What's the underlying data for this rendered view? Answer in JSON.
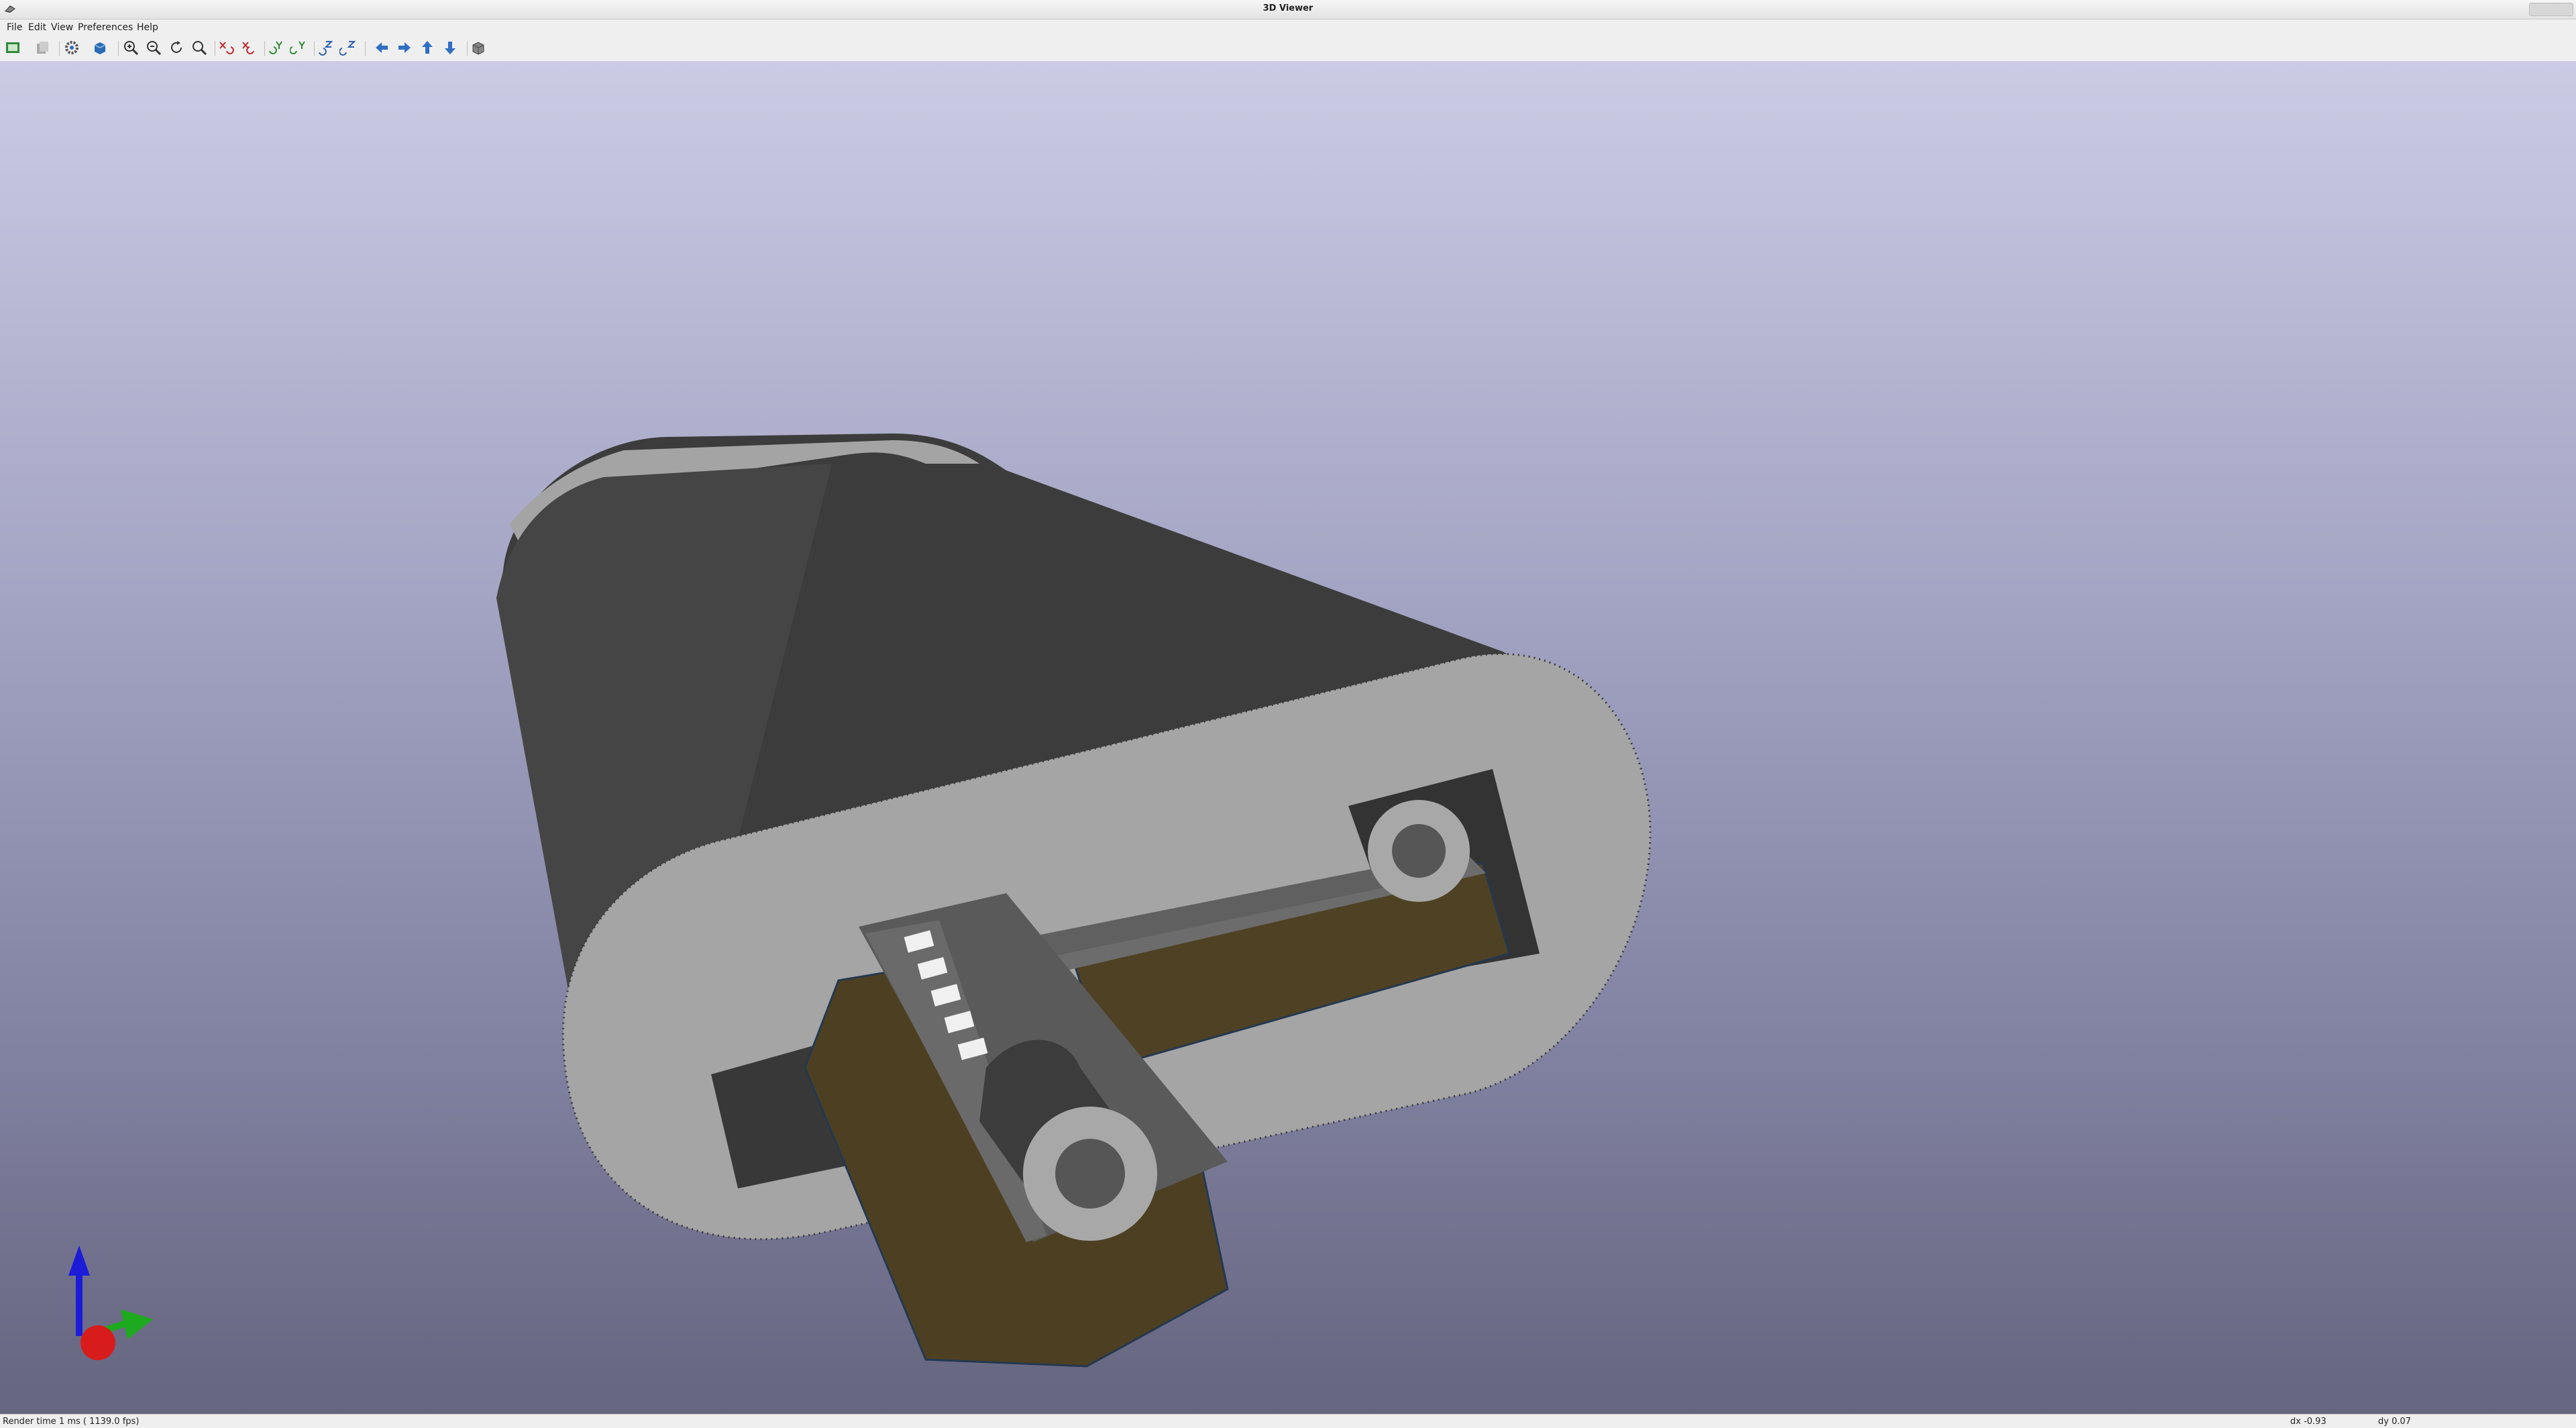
{
  "window": {
    "title": "3D Viewer"
  },
  "menu": {
    "file": "File",
    "edit": "Edit",
    "view": "View",
    "preferences": "Preferences",
    "help": "Help"
  },
  "toolbar": {
    "icons": [
      "export-image-icon",
      "copy-image-icon",
      "render-settings-icon",
      "render-mode-icon",
      "zoom-in-icon",
      "zoom-out-icon",
      "redraw-icon",
      "zoom-fit-icon",
      "rotate-x-cw-icon",
      "rotate-x-ccw-icon",
      "rotate-y-cw-icon",
      "rotate-y-ccw-icon",
      "rotate-z-cw-icon",
      "rotate-z-ccw-icon",
      "pan-left-icon",
      "pan-right-icon",
      "pan-up-icon",
      "pan-down-icon",
      "ortho-toggle-icon"
    ]
  },
  "status": {
    "render_time": "Render time 1 ms ( 1139.0 fps)",
    "dx": "dx -0.93",
    "dy": "dy 0.07"
  },
  "colors": {
    "enclosure_dark": "#3f3f3f",
    "enclosure_face": "#a5a5a5",
    "pcb": "#4f4224",
    "background_top": "#cbcbe4",
    "background_bottom": "#65657f"
  }
}
